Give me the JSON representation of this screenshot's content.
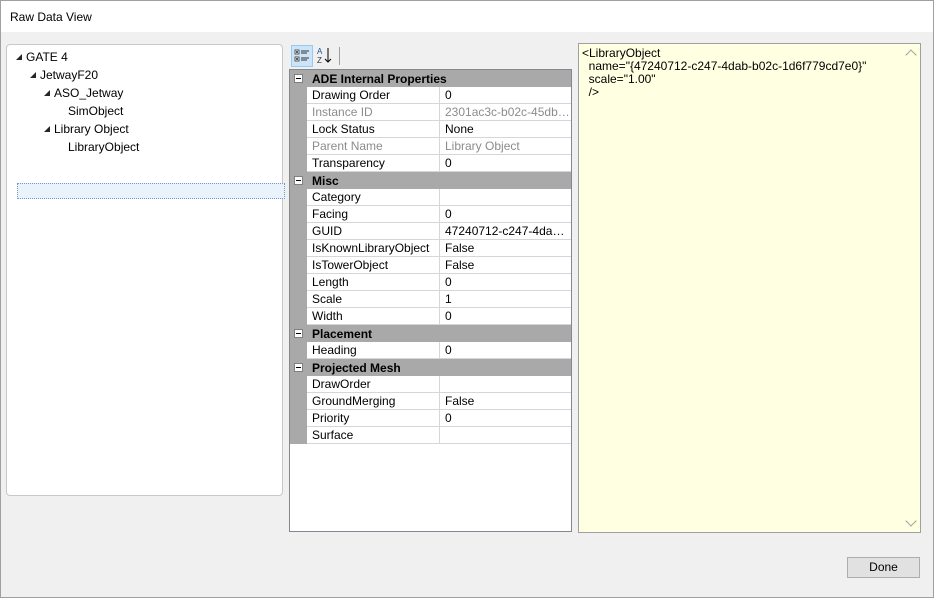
{
  "window": {
    "title": "Raw Data View"
  },
  "tree": {
    "nodes": [
      {
        "label": "GATE 4",
        "expanded": true
      },
      {
        "label": "JetwayF20",
        "expanded": true
      },
      {
        "label": "ASO_Jetway",
        "expanded": true
      },
      {
        "label": "SimObject"
      },
      {
        "label": "Library Object",
        "expanded": true
      },
      {
        "label": "LibraryObject",
        "selected": true
      }
    ]
  },
  "toolbar": {
    "categorized_icon": "categorized-icon",
    "alphabetical_icon": "sort-alphabetical-icon"
  },
  "property_grid": {
    "categories": [
      {
        "name": "ADE Internal Properties",
        "props": [
          {
            "name": "Drawing Order",
            "value": "0"
          },
          {
            "name": "Instance ID",
            "value": "2301ac3c-b02c-45db-b6...",
            "readonly": true
          },
          {
            "name": "Lock Status",
            "value": "None"
          },
          {
            "name": "Parent Name",
            "value": "Library Object",
            "readonly": true
          },
          {
            "name": "Transparency",
            "value": "0"
          }
        ]
      },
      {
        "name": "Misc",
        "props": [
          {
            "name": "Category",
            "value": ""
          },
          {
            "name": "Facing",
            "value": "0"
          },
          {
            "name": "GUID",
            "value": "47240712-c247-4dab-b0..."
          },
          {
            "name": "IsKnownLibraryObject",
            "value": "False"
          },
          {
            "name": "IsTowerObject",
            "value": "False"
          },
          {
            "name": "Length",
            "value": "0"
          },
          {
            "name": "Scale",
            "value": "1"
          },
          {
            "name": "Width",
            "value": "0"
          }
        ]
      },
      {
        "name": "Placement",
        "props": [
          {
            "name": "Heading",
            "value": "0"
          }
        ]
      },
      {
        "name": "Projected Mesh",
        "props": [
          {
            "name": "DrawOrder",
            "value": ""
          },
          {
            "name": "GroundMerging",
            "value": "False"
          },
          {
            "name": "Priority",
            "value": "0"
          },
          {
            "name": "Surface",
            "value": ""
          }
        ]
      }
    ]
  },
  "xml": {
    "lines": [
      "<LibraryObject",
      "  name=\"{47240712-c247-4dab-b02c-1d6f779cd7e0}\"",
      "  scale=\"1.00\"",
      "  />"
    ]
  },
  "buttons": {
    "done": "Done"
  }
}
